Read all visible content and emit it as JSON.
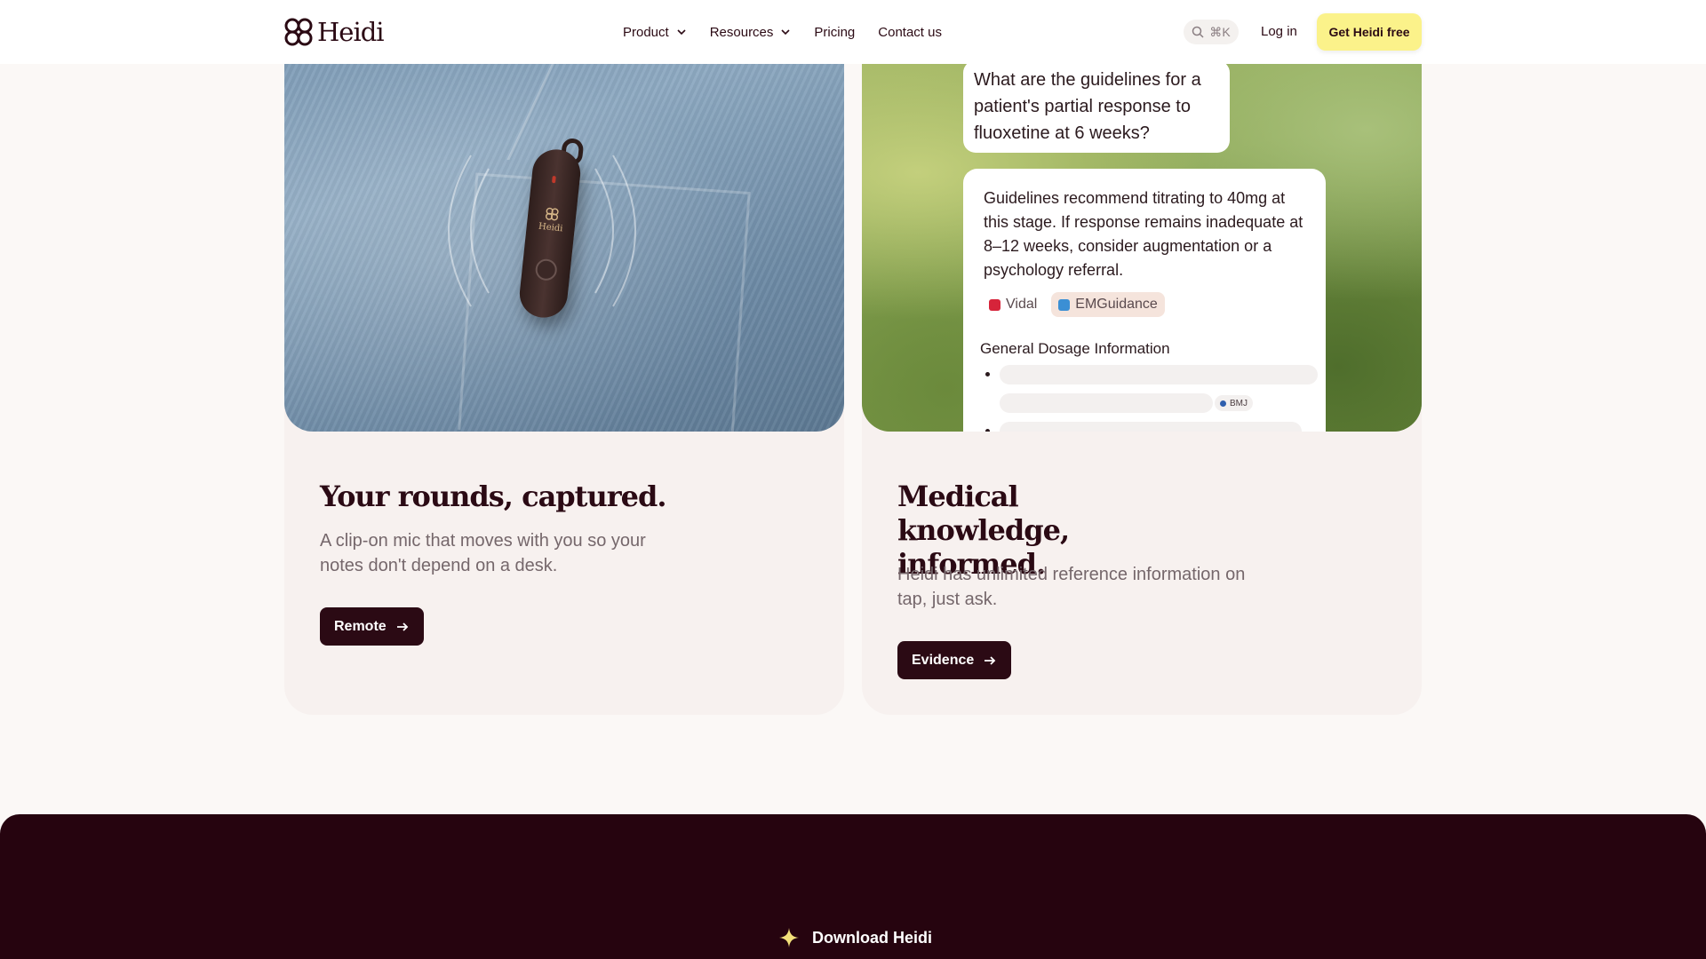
{
  "nav": {
    "brand": "Heidi",
    "links": [
      {
        "label": "Product",
        "has_dropdown": true
      },
      {
        "label": "Resources",
        "has_dropdown": true
      },
      {
        "label": "Pricing",
        "has_dropdown": false
      },
      {
        "label": "Contact us",
        "has_dropdown": false
      }
    ],
    "search_shortcut": "⌘K",
    "login": "Log in",
    "cta": "Get Heidi free"
  },
  "cards": [
    {
      "title": "Your rounds, captured.",
      "description": "A clip-on mic that moves with you so your notes don't depend on a desk.",
      "button": "Remote",
      "device_label": "Heidi"
    },
    {
      "title": "Medical knowledge, informed.",
      "description": "Heidi has unlimited reference information on tap, just ask.",
      "button": "Evidence",
      "chat": {
        "question": "What are the guidelines for a patient's partial response to fluoxetine at 6 weeks?",
        "answer": "Guidelines recommend titrating to 40mg at this stage. If response remains inadequate at 8–12 weeks, consider augmentation or a psychology referral.",
        "sources": [
          "Vidal",
          "EMGuidance"
        ],
        "section_title": "General Dosage Information",
        "inline_source": "BMJ"
      }
    }
  ],
  "footer": {
    "download_label": "Download Heidi"
  },
  "colors": {
    "brand_dark": "#2b0a14",
    "cta_yellow": "#fbf28a",
    "band": "#26040f"
  }
}
